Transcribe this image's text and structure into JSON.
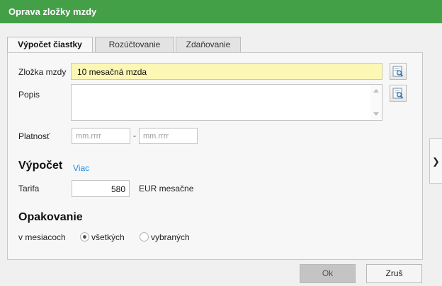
{
  "window": {
    "title": "Oprava zložky mzdy"
  },
  "tabs": [
    {
      "label": "Výpočet čiastky",
      "active": true
    },
    {
      "label": "Rozúčtovanie",
      "active": false
    },
    {
      "label": "Zdaňovanie",
      "active": false
    }
  ],
  "form": {
    "zlozka": {
      "label": "Zložka mzdy",
      "value": "10  mesačná mzda"
    },
    "popis": {
      "label": "Popis",
      "value": ""
    },
    "platnost": {
      "label": "Platnosť",
      "from_placeholder": "mm.rrrr",
      "to_placeholder": "mm.rrrr",
      "separator": "-"
    }
  },
  "vypocet": {
    "title": "Výpočet",
    "more_link": "Viac",
    "tarifa": {
      "label": "Tarifa",
      "value": "580",
      "unit": "EUR mesačne"
    }
  },
  "opakovanie": {
    "title": "Opakovanie",
    "label": "v mesiacoch",
    "options": [
      {
        "label": "všetkých",
        "selected": true
      },
      {
        "label": "vybraných",
        "selected": false
      }
    ]
  },
  "buttons": {
    "ok": "Ok",
    "cancel": "Zruš"
  },
  "icons": {
    "lookup": "lookup-search-icon",
    "side": "chevron-right-icon"
  },
  "colors": {
    "titlebar": "#43a047",
    "required_field": "#fcf7b5",
    "link": "#1e88e5"
  }
}
